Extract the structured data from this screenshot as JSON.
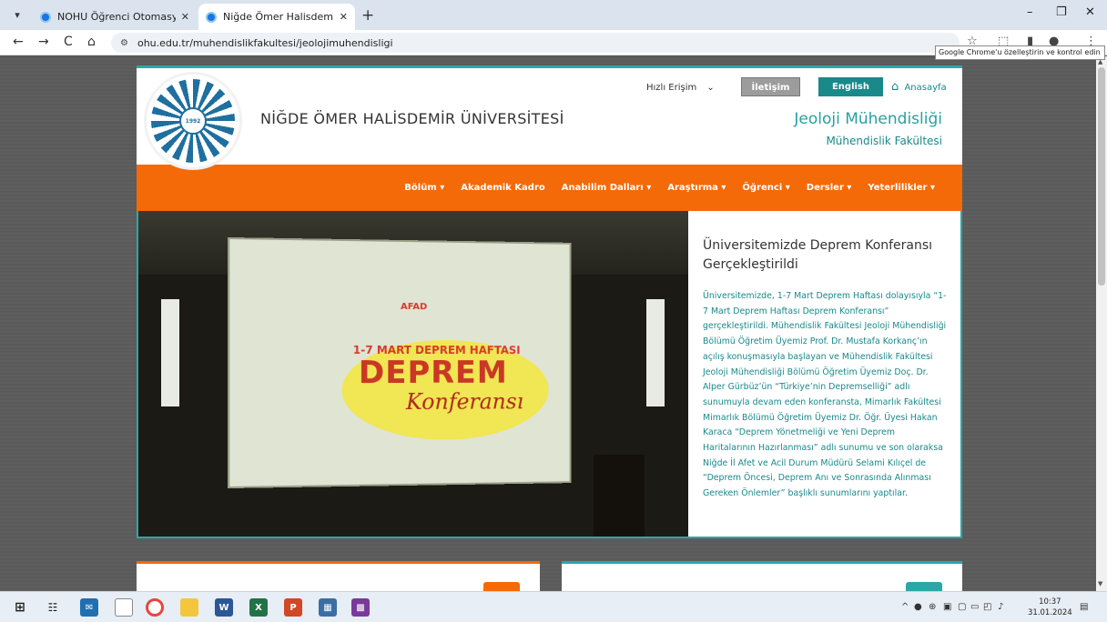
{
  "browser": {
    "tabs": [
      {
        "title": "NOHU Öğrenci Otomasyon Sist",
        "close": "✕"
      },
      {
        "title": "Niğde Ömer Halisdemir Üniver",
        "close": "✕"
      }
    ],
    "new_tab": "+",
    "address": "ohu.edu.tr/muhendislikfakultesi/jeolojimuhendisligi",
    "tooltip": "Google Chrome'u özelleştirin ve kontrol edin",
    "window_controls": {
      "minimize": "–",
      "restore": "❐",
      "close": "✕"
    },
    "nav": {
      "back": "←",
      "forward": "→",
      "reload": "C",
      "home": "⌂"
    }
  },
  "site": {
    "logo_text": "NİĞDE ÖMER HALİSDEMİR ÜNİVERSİTESİ",
    "logo_year": "1992",
    "university_name": "NİĞDE ÖMER HALİSDEMİR ÜNİVERSİTESİ",
    "quick_access": "Hızlı Erişim",
    "contact_button": "İletişim",
    "english_button": "English",
    "home_link": "Anasayfa",
    "department": "Jeoloji Mühendisliği",
    "faculty": "Mühendislik Fakültesi",
    "menu": [
      {
        "label": "Bölüm ▾"
      },
      {
        "label": "Akademik Kadro"
      },
      {
        "label": "Anabilim Dalları ▾"
      },
      {
        "label": "Araştırma ▾"
      },
      {
        "label": "Öğrenci ▾"
      },
      {
        "label": "Dersler ▾"
      },
      {
        "label": "Yeterlilikler ▾"
      }
    ],
    "news": {
      "title": "Üniversitemizde Deprem Konferansı Gerçekleştirildi",
      "body": "Üniversitemizde, 1-7 Mart Deprem Haftası dolayısıyla “1-7 Mart Deprem Haftası Deprem Konferansı” gerçekleştirildi. Mühendislik Fakültesi Jeoloji Mühendisliği Bölümü Öğretim Üyemiz Prof. Dr. Mustafa Korkanç’ın açılış konuşmasıyla başlayan ve Mühendislik Fakültesi Jeoloji Mühendisliği Bölümü Öğretim Üyemiz Doç. Dr. Alper Gürbüz’ün “Türkiye’nin Depremselliği” adlı sunumuyla devam eden konferansta, Mimarlık Fakültesi Mimarlık Bölümü Öğretim Üyemiz Dr. Öğr. Üyesi Hakan Karaca “Deprem Yönetmeliği ve Yeni Deprem Haritalarının Hazırlanması” adlı sunumu ve son olaraksa Niğde İl Afet ve Acil Durum Müdürü Selami Kılıçel de “Deprem Öncesi, Deprem Anı ve Sonrasında Alınması Gereken Önlemler” başlıklı sunumlarını yaptılar."
    },
    "poster": {
      "afad": "AFAD",
      "week": "1-7 MART DEPREM HAFTASI",
      "big": "DEPREM",
      "sub": "Konferansı"
    }
  },
  "taskbar": {
    "time": "10:37",
    "date": "31.01.2024"
  },
  "colors": {
    "accent_orange": "#f46a08",
    "accent_teal": "#2aa8a8"
  }
}
